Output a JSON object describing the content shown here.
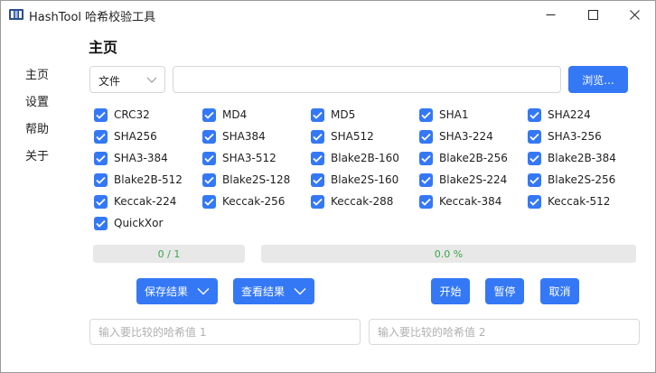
{
  "window": {
    "title": "HashTool 哈希校验工具",
    "icon": "app-icon",
    "controls": [
      "minimize-icon",
      "maximize-icon",
      "close-icon"
    ]
  },
  "sidebar": {
    "items": [
      {
        "label": "主页"
      },
      {
        "label": "设置"
      },
      {
        "label": "帮助"
      },
      {
        "label": "关于"
      }
    ]
  },
  "main": {
    "title": "主页",
    "source_select": {
      "value": "文件"
    },
    "path_input": {
      "value": "",
      "placeholder": ""
    },
    "browse_label": "浏览...",
    "algorithms": [
      {
        "label": "CRC32",
        "checked": true
      },
      {
        "label": "MD4",
        "checked": true
      },
      {
        "label": "MD5",
        "checked": true
      },
      {
        "label": "SHA1",
        "checked": true
      },
      {
        "label": "SHA224",
        "checked": true
      },
      {
        "label": "SHA256",
        "checked": true
      },
      {
        "label": "SHA384",
        "checked": true
      },
      {
        "label": "SHA512",
        "checked": true
      },
      {
        "label": "SHA3-224",
        "checked": true
      },
      {
        "label": "SHA3-256",
        "checked": true
      },
      {
        "label": "SHA3-384",
        "checked": true
      },
      {
        "label": "SHA3-512",
        "checked": true
      },
      {
        "label": "Blake2B-160",
        "checked": true
      },
      {
        "label": "Blake2B-256",
        "checked": true
      },
      {
        "label": "Blake2B-384",
        "checked": true
      },
      {
        "label": "Blake2B-512",
        "checked": true
      },
      {
        "label": "Blake2S-128",
        "checked": true
      },
      {
        "label": "Blake2S-160",
        "checked": true
      },
      {
        "label": "Blake2S-224",
        "checked": true
      },
      {
        "label": "Blake2S-256",
        "checked": true
      },
      {
        "label": "Keccak-224",
        "checked": true
      },
      {
        "label": "Keccak-256",
        "checked": true
      },
      {
        "label": "Keccak-288",
        "checked": true
      },
      {
        "label": "Keccak-384",
        "checked": true
      },
      {
        "label": "Keccak-512",
        "checked": true
      },
      {
        "label": "QuickXor",
        "checked": true
      }
    ],
    "progress": {
      "count_text": "0 / 1",
      "percent_text": "0.0 %"
    },
    "buttons": {
      "save": "保存结果",
      "view": "查看结果",
      "start": "开始",
      "pause": "暂停",
      "cancel": "取消"
    },
    "compare": {
      "placeholder1": "输入要比较的哈希值 1",
      "placeholder2": "输入要比较的哈希值 2"
    }
  },
  "colors": {
    "accent": "#3478f6",
    "progress_text": "#3aa54a",
    "progress_track": "#e8e8e8"
  }
}
